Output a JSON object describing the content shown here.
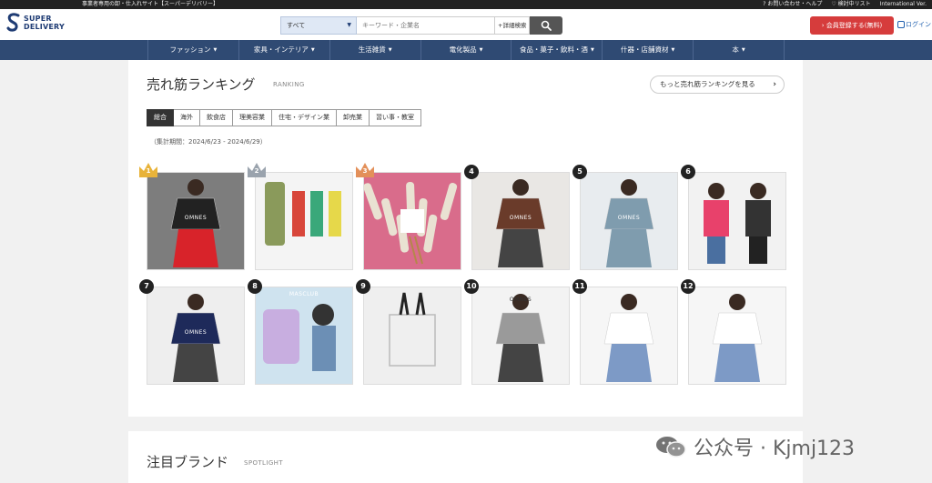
{
  "topbar": {
    "tagline": "事業者専用の卸・仕入れサイト【スーパーデリバリー】",
    "links": [
      "? お問い合わせ・ヘルプ",
      "♡ 検討中リスト",
      "International Ver."
    ]
  },
  "header": {
    "logo_line1": "SUPER",
    "logo_line2": "DELIVERY",
    "search_category": "すべて",
    "search_placeholder": "キーワード・企業名",
    "advanced_search": "+詳細検索",
    "signup_label": "› 会員登録する(無料)",
    "login_label": "ログイン"
  },
  "nav": {
    "items": [
      "ファッション",
      "家具・インテリア",
      "生活雑貨",
      "電化製品",
      "食品・菓子・飲料・酒",
      "什器・店舗資材",
      "本"
    ]
  },
  "ranking": {
    "title": "売れ筋ランキング",
    "subtitle": "RANKING",
    "more_label": "もっと売れ筋ランキングを見る",
    "tabs": [
      "総合",
      "海外",
      "飲食店",
      "理美容業",
      "住宅・デザイン業",
      "卸売業",
      "習い事・教室"
    ],
    "active_tab": 0,
    "period": "（集計期間：2024/6/23 - 2024/6/29）",
    "products": [
      {
        "rank": "1",
        "brand": "OMNES",
        "bg": "#7d7d7d",
        "accent": "#d8232a"
      },
      {
        "rank": "2",
        "brand": "",
        "bg": "#f4f4f4",
        "accent": "#8a9a5b"
      },
      {
        "rank": "3",
        "brand": "",
        "bg": "#d96c8b",
        "accent": "#b5874a"
      },
      {
        "rank": "4",
        "brand": "OMNES",
        "bg": "#e9e7e4",
        "accent": "#6a3b2a"
      },
      {
        "rank": "5",
        "brand": "OMNES",
        "bg": "#e8ecef",
        "accent": "#7f9cae"
      },
      {
        "rank": "6",
        "brand": "",
        "bg": "#f2f2f2",
        "accent": "#e8416b"
      },
      {
        "rank": "7",
        "brand": "OMNES",
        "bg": "#eeeeee",
        "accent": "#1e2a5a"
      },
      {
        "rank": "8",
        "brand": "MASCLUB",
        "bg": "#cfe3ef",
        "accent": "#c8aee0"
      },
      {
        "rank": "9",
        "brand": "",
        "bg": "#efefef",
        "accent": "#222222"
      },
      {
        "rank": "10",
        "brand": "OMNES",
        "bg": "#f3f3f3",
        "accent": "#9a9a9a"
      },
      {
        "rank": "11",
        "brand": "",
        "bg": "#f6f6f6",
        "accent": "#c87fa8"
      },
      {
        "rank": "12",
        "brand": "",
        "bg": "#f6f6f6",
        "accent": "#ffffff"
      }
    ]
  },
  "spotlight": {
    "title": "注目ブランド",
    "subtitle": "SPOTLIGHT"
  },
  "watermark": {
    "text": "公众号 · Kjmj123"
  },
  "colors": {
    "nav_bg": "#2f4a73",
    "signup_bg": "#d63c3c",
    "gold": "#e8b33a",
    "silver": "#9aa3ad",
    "bronze": "#e3905a"
  }
}
